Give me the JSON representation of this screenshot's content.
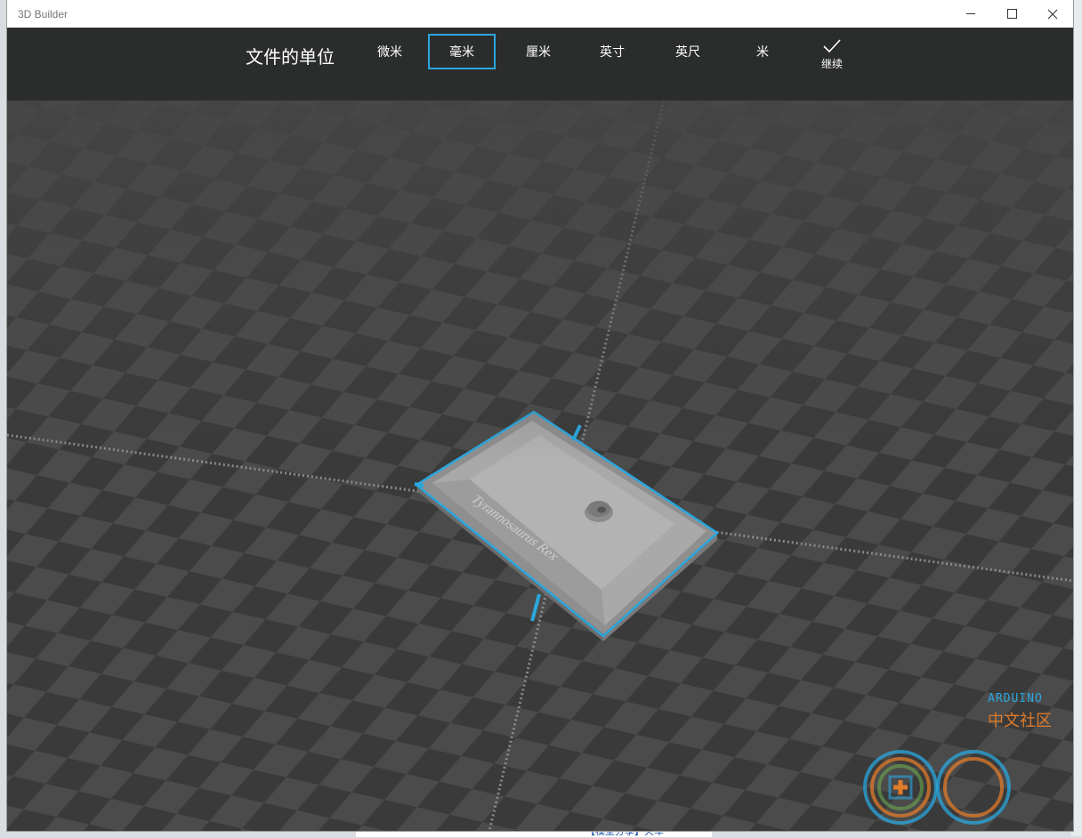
{
  "window": {
    "title": "3D Builder"
  },
  "toolbar": {
    "title": "文件的单位",
    "units": [
      {
        "label": "微米",
        "selected": false
      },
      {
        "label": "毫米",
        "selected": true
      },
      {
        "label": "厘米",
        "selected": false
      },
      {
        "label": "英寸",
        "selected": false
      },
      {
        "label": "英尺",
        "selected": false
      },
      {
        "label": "米",
        "selected": false
      }
    ],
    "continue_label": "继续",
    "continue_icon": "checkmark-icon",
    "accent_color": "#2aa7de"
  },
  "model": {
    "engraved_text": "Tyrannosaurus Rex"
  },
  "watermark": {
    "line1": "ARDUINO",
    "line2": "中文社区"
  },
  "background": {
    "link_text": "【模型分享】火车"
  },
  "colors": {
    "toolbar_bg": "#2b2d2d",
    "grid_dark": "#3a3a3a",
    "grid_light": "#4a4a4a",
    "selection": "#2aa7de",
    "model": "#a9a9a9"
  }
}
